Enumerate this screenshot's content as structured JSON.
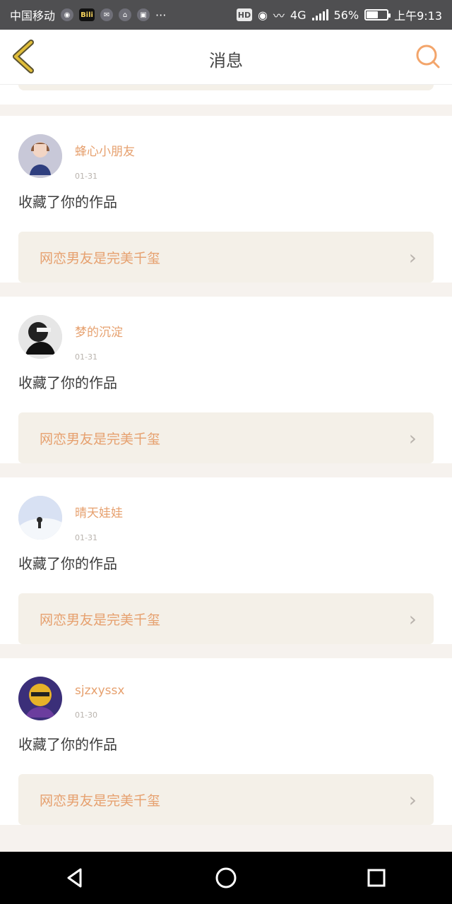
{
  "status_bar": {
    "carrier": "中国移动",
    "time": "上午9:13",
    "battery": "56%",
    "network": "4G",
    "hd_label": "HD",
    "more": "···",
    "bili": "Bili"
  },
  "header": {
    "title": "消息"
  },
  "notifications": [
    {
      "username": "蜂心小朋友",
      "date": "01-31",
      "action": "收藏了你的作品",
      "work_title": "网恋男友是完美千玺"
    },
    {
      "username": "梦的沉淀",
      "date": "01-31",
      "action": "收藏了你的作品",
      "work_title": "网恋男友是完美千玺"
    },
    {
      "username": "晴天娃娃",
      "date": "01-31",
      "action": "收藏了你的作品",
      "work_title": "网恋男友是完美千玺"
    },
    {
      "username": "sjzxyssx",
      "date": "01-30",
      "action": "收藏了你的作品",
      "work_title": "网恋男友是完美千玺"
    }
  ],
  "colors": {
    "accent": "#e6a06e",
    "bar": "#4f4f51",
    "card_bg": "#f4f0e8"
  },
  "icons": {
    "back": "back-chevron-icon",
    "search": "search-icon",
    "chevron": "chevron-right-icon",
    "nav_back": "triangle-back-icon",
    "nav_home": "circle-home-icon",
    "nav_recent": "square-recent-icon"
  }
}
